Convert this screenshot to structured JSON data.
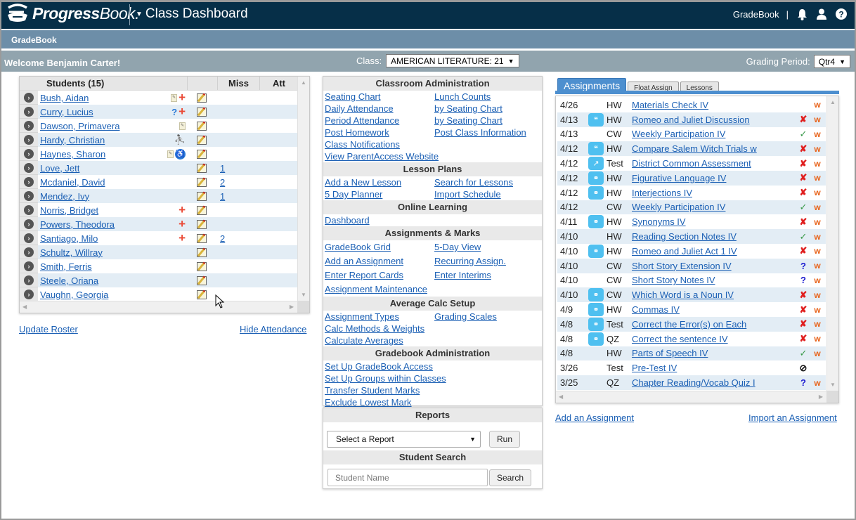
{
  "header": {
    "logo_text_bold": "Progress",
    "logo_text_rest": "Book.",
    "app_title": "Class Dashboard",
    "right_link": "GradeBook",
    "right_sep": "|",
    "icons": [
      "bell-icon",
      "user-icon",
      "help-icon"
    ]
  },
  "subnav": {
    "label": "GradeBook"
  },
  "welcome": {
    "text": "Welcome Benjamin Carter!",
    "class_label": "Class:",
    "class_value": "AMERICAN LITERATURE: 21",
    "grading_label": "Grading Period:",
    "grading_value": "Qtr4"
  },
  "students": {
    "header": {
      "name": "Students (15)",
      "miss": "Miss",
      "att": "Att"
    },
    "rows": [
      {
        "name": "Bush, Aidan",
        "flags": [
          "note",
          "medical"
        ],
        "miss": ""
      },
      {
        "name": "Curry, Lucius",
        "flags": [
          "unknown",
          "medical"
        ],
        "miss": ""
      },
      {
        "name": "Dawson, Primavera",
        "flags": [
          "note"
        ],
        "miss": ""
      },
      {
        "name": "Hardy, Christian",
        "flags": [
          "family"
        ],
        "miss": ""
      },
      {
        "name": "Haynes, Sharon",
        "flags": [
          "note",
          "accessibility"
        ],
        "miss": ""
      },
      {
        "name": "Love, Jett",
        "flags": [],
        "miss": "1"
      },
      {
        "name": "Mcdaniel, David",
        "flags": [],
        "miss": "2"
      },
      {
        "name": "Mendez, Ivy",
        "flags": [],
        "miss": "1"
      },
      {
        "name": "Norris, Bridget",
        "flags": [
          "medical"
        ],
        "miss": ""
      },
      {
        "name": "Powers, Theodora",
        "flags": [
          "medical"
        ],
        "miss": ""
      },
      {
        "name": "Santiago, Milo",
        "flags": [
          "medical"
        ],
        "miss": "2"
      },
      {
        "name": "Schultz, Willray",
        "flags": [],
        "miss": ""
      },
      {
        "name": "Smith, Ferris",
        "flags": [],
        "miss": ""
      },
      {
        "name": "Steele, Oriana",
        "flags": [],
        "miss": ""
      },
      {
        "name": "Vaughn, Georgia",
        "flags": [],
        "miss": ""
      }
    ],
    "update_roster": "Update Roster",
    "hide_attendance": "Hide Attendance"
  },
  "admin": {
    "sections": [
      {
        "title": "Classroom Administration",
        "links": [
          [
            "Seating Chart",
            "Lunch Counts"
          ],
          [
            "Daily Attendance",
            "by Seating Chart"
          ],
          [
            "Period Attendance",
            "by Seating Chart"
          ],
          [
            "Post Homework",
            "Post Class Information"
          ],
          [
            "Class Notifications",
            ""
          ],
          [
            "View ParentAccess Website",
            ""
          ]
        ]
      },
      {
        "title": "Lesson Plans",
        "links": [
          [
            "Add a New Lesson",
            "Search for Lessons"
          ],
          [
            "5 Day Planner",
            "Import Schedule"
          ]
        ]
      },
      {
        "title": "Online Learning",
        "links": [
          [
            "Dashboard",
            ""
          ]
        ]
      },
      {
        "title": "Assignments & Marks",
        "spaced": true,
        "links": [
          [
            "GradeBook Grid",
            "5-Day View"
          ],
          [
            "Add an Assignment",
            "Recurring Assign."
          ],
          [
            "Enter Report Cards",
            "Enter Interims"
          ],
          [
            "Assignment Maintenance",
            ""
          ]
        ]
      },
      {
        "title": "Average Calc Setup",
        "links": [
          [
            "Assignment Types",
            "Grading Scales"
          ],
          [
            "Calc Methods & Weights",
            ""
          ],
          [
            "Calculate Averages",
            ""
          ]
        ]
      },
      {
        "title": "Gradebook Administration",
        "links": [
          [
            "Set Up GradeBook Access",
            ""
          ],
          [
            "Set Up Groups within Classes",
            ""
          ],
          [
            "Transfer Student Marks",
            ""
          ],
          [
            "Exclude Lowest Mark",
            ""
          ]
        ]
      }
    ],
    "reports_title": "Reports",
    "report_select": "Select a Report",
    "run_label": "Run",
    "search_title": "Student Search",
    "search_placeholder": "Student Name",
    "search_label": "Search"
  },
  "assignments": {
    "tabs": [
      "Assignments",
      "Float Assign",
      "Lessons"
    ],
    "rows": [
      {
        "date": "4/26",
        "tool": "",
        "type": "HW",
        "name": "Materials Check IV",
        "status": "",
        "w": "w"
      },
      {
        "date": "4/13",
        "tool": "discussion",
        "type": "HW",
        "name": "Romeo and Juliet Discussion",
        "status": "x",
        "w": "w"
      },
      {
        "date": "4/13",
        "tool": "",
        "type": "CW",
        "name": "Weekly Participation IV",
        "status": "ok",
        "w": "w"
      },
      {
        "date": "4/12",
        "tool": "discussion",
        "type": "HW",
        "name": "Compare Salem Witch Trials w",
        "status": "x",
        "w": "w"
      },
      {
        "date": "4/12",
        "tool": "chart",
        "type": "Test",
        "name": "District Common Assessment",
        "status": "x",
        "w": "w"
      },
      {
        "date": "4/12",
        "tool": "quiz",
        "type": "HW",
        "name": "Figurative Language IV",
        "status": "x",
        "w": "w"
      },
      {
        "date": "4/12",
        "tool": "quiz",
        "type": "HW",
        "name": "Interjections IV",
        "status": "x",
        "w": "w"
      },
      {
        "date": "4/12",
        "tool": "",
        "type": "CW",
        "name": "Weekly Participation IV",
        "status": "ok",
        "w": "w"
      },
      {
        "date": "4/11",
        "tool": "quiz",
        "type": "HW",
        "name": "Synonyms IV",
        "status": "x",
        "w": "w"
      },
      {
        "date": "4/10",
        "tool": "",
        "type": "HW",
        "name": "Reading Section Notes IV",
        "status": "ok",
        "w": "w"
      },
      {
        "date": "4/10",
        "tool": "quiz",
        "type": "HW",
        "name": "Romeo and Juliet Act 1 IV",
        "status": "x",
        "w": "w"
      },
      {
        "date": "4/10",
        "tool": "",
        "type": "CW",
        "name": "Short Story Extension IV",
        "status": "q",
        "w": "w"
      },
      {
        "date": "4/10",
        "tool": "",
        "type": "CW",
        "name": "Short Story Notes IV",
        "status": "q",
        "w": "w"
      },
      {
        "date": "4/10",
        "tool": "quiz",
        "type": "CW",
        "name": "Which Word is a Noun IV",
        "status": "x",
        "w": "w"
      },
      {
        "date": "4/9",
        "tool": "quiz",
        "type": "HW",
        "name": "Commas IV",
        "status": "x",
        "w": "w"
      },
      {
        "date": "4/8",
        "tool": "quiz",
        "type": "Test",
        "name": "Correct the Error(s) on Each",
        "status": "x",
        "w": "w"
      },
      {
        "date": "4/8",
        "tool": "quiz",
        "type": "QZ",
        "name": "Correct the sentence IV",
        "status": "x",
        "w": "w"
      },
      {
        "date": "4/8",
        "tool": "",
        "type": "HW",
        "name": "Parts of Speech IV",
        "status": "ok",
        "w": "w"
      },
      {
        "date": "3/26",
        "tool": "",
        "type": "Test",
        "name": "Pre-Test IV",
        "status": "no",
        "w": ""
      },
      {
        "date": "3/25",
        "tool": "",
        "type": "QZ",
        "name": "Chapter Reading/Vocab Quiz I",
        "status": "q",
        "w": "w"
      }
    ],
    "add_link": "Add an Assignment",
    "import_link": "Import an Assignment"
  }
}
